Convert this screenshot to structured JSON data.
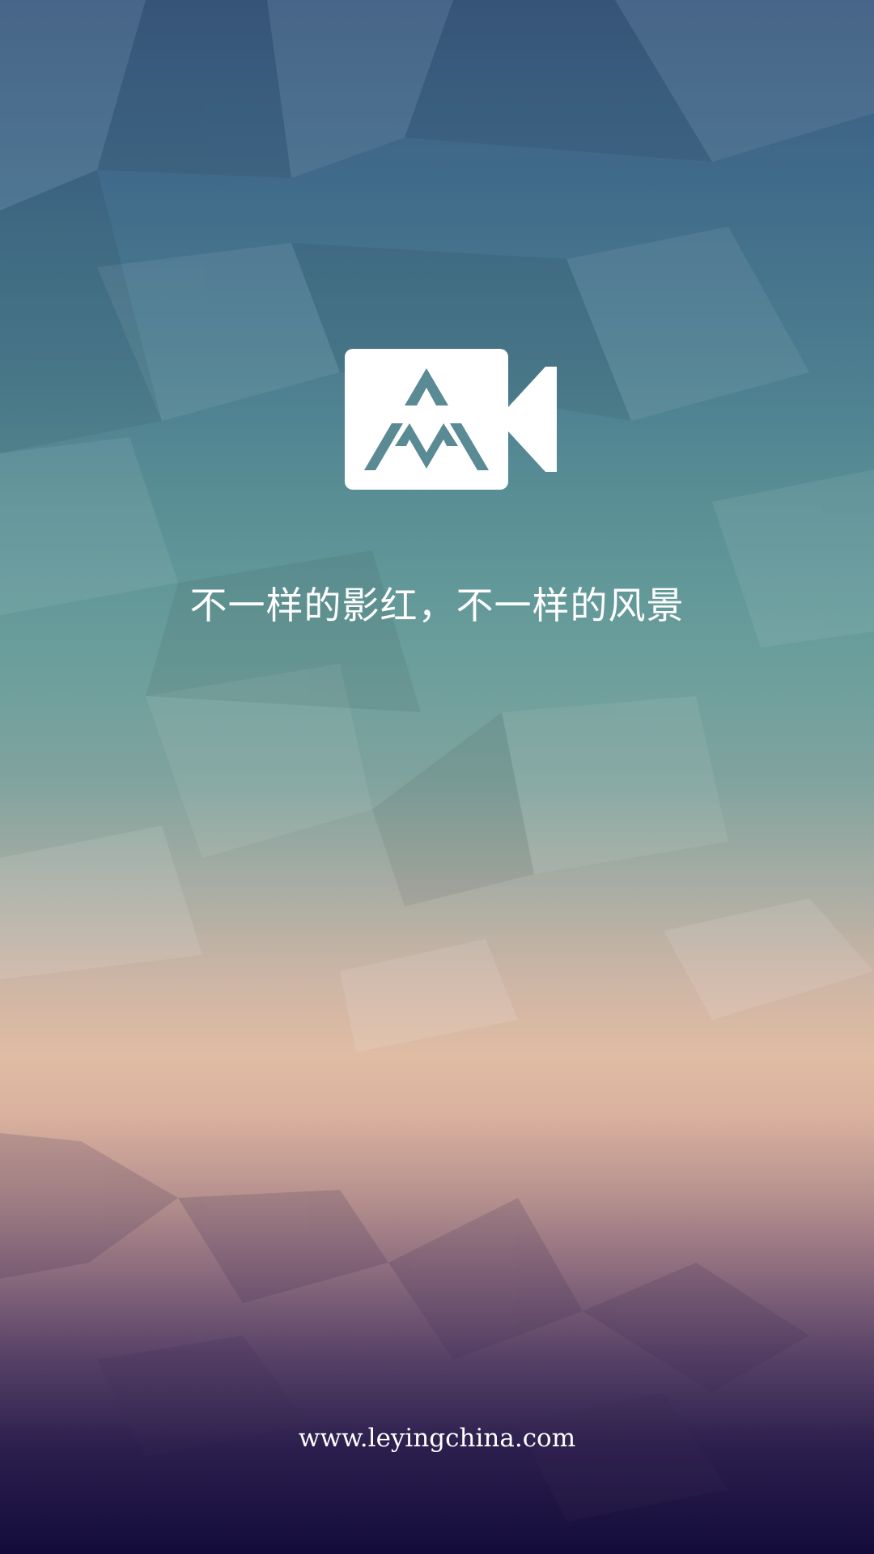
{
  "splash": {
    "tagline": "不一样的影红，不一样的风景",
    "website": "www.leyingchina.com",
    "logo_icon": "video-camera-mountain-logo"
  },
  "colors": {
    "text": "#ffffff",
    "logo_fill": "#ffffff",
    "logo_mark": "#5a8a94",
    "sky_top": "#3a5a80",
    "sky_mid": "#6a9e9c",
    "horizon": "#e0bca4",
    "ground_bottom": "#130c3a"
  }
}
